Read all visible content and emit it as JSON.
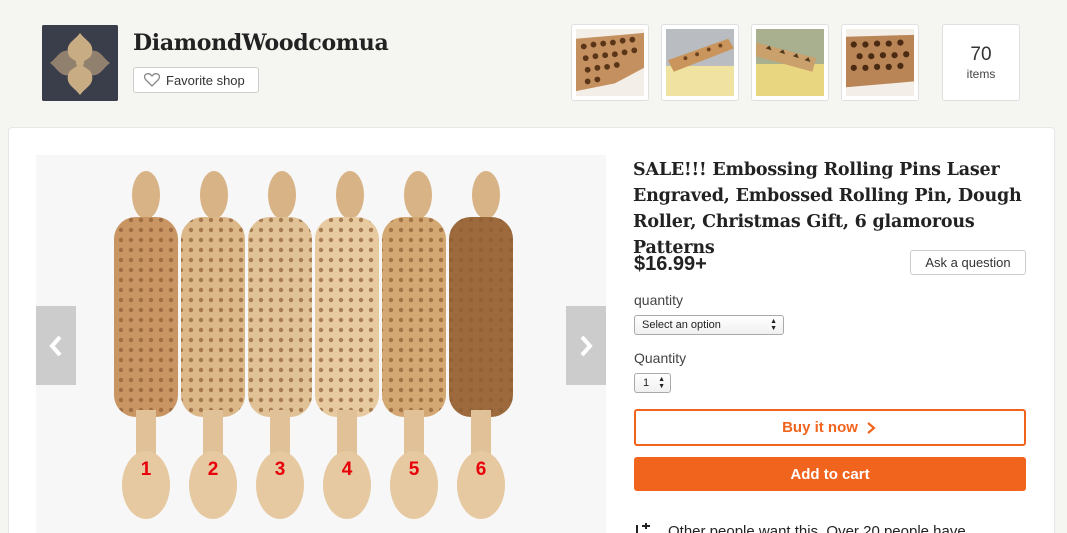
{
  "shop": {
    "name": "DiamondWoodcomua",
    "favorite_label": "Favorite shop",
    "items_count": "70",
    "items_label": "items"
  },
  "listing": {
    "title": "SALE!!! Embossing Rolling Pins Laser Engraved, Embossed Rolling Pin, Dough Roller, Christmas Gift, 6 glamorous Patterns",
    "price": "$16.99+",
    "ask_label": "Ask a question",
    "quantity_option_label": "quantity",
    "select_placeholder": "Select an option",
    "quantity_label": "Quantity",
    "quantity_value": "1",
    "buy_now_label": "Buy it now",
    "add_to_cart_label": "Add to cart",
    "teaser_text": "Other people want this. Over 20 people have"
  },
  "gallery": {
    "pin_numbers": [
      "1",
      "2",
      "3",
      "4",
      "5",
      "6"
    ]
  },
  "colors": {
    "accent": "#f1641e",
    "number_red": "#e8000b"
  }
}
